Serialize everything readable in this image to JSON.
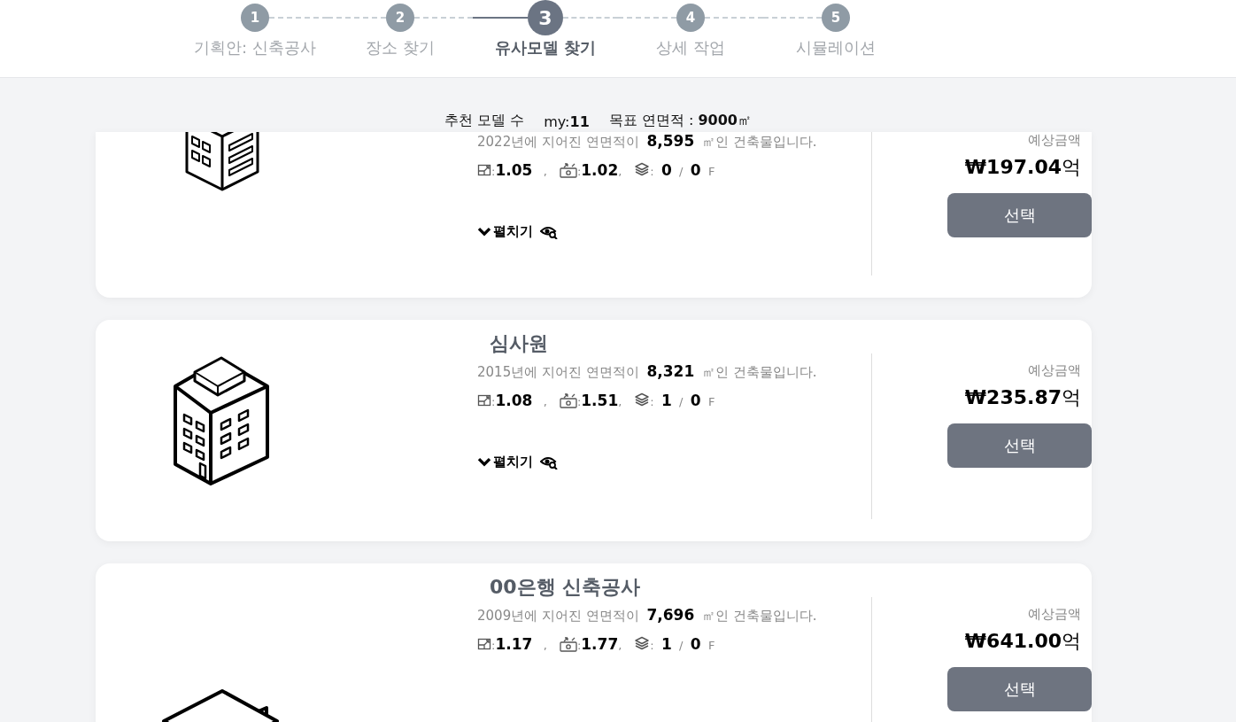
{
  "steps": [
    {
      "number": "1",
      "label": "기획안: 신축공사",
      "selected": false
    },
    {
      "number": "2",
      "label": "장소 찾기",
      "selected": false
    },
    {
      "number": "3",
      "label": "유사모델 찾기",
      "selected": true
    },
    {
      "number": "4",
      "label": "상세 작업",
      "selected": false
    },
    {
      "number": "5",
      "label": "시뮬레이션",
      "selected": false
    }
  ],
  "summary": {
    "label": "추천 모델 수",
    "count": "my:**11**",
    "target": "목표 연면적 : **9000**㎡"
  },
  "models": [
    {
      "kind": "office",
      "description": "2022년에 지어진 연면적이 **8,595** ㎡인 건축물입니다.",
      "stats": [
        {
          "text": ":**1.05**   ,"
        },
        {
          "text": ":**1.02**,"
        },
        {
          "text": ":  **0**  /  **0**  F"
        }
      ],
      "expand": "펼치기",
      "price_label": "예상금액",
      "price": "**₩197.04**억",
      "button": "선택"
    },
    {
      "kind": "tower",
      "title": "심사원",
      "description": "2015년에 지어진 연면적이 **8,321** ㎡인 건축물입니다.",
      "stats": [
        {
          "text": ":**1.08**   ,"
        },
        {
          "text": ":**1.51**,"
        },
        {
          "text": ":  **1**  /  **0**  F"
        }
      ],
      "expand": "펼치기",
      "price_label": "예상금액",
      "price": "**₩235.87**억",
      "button": "선택"
    },
    {
      "kind": "bank",
      "title": "00은행 신축공사",
      "description": "2009년에 지어진 연면적이 **7,696** ㎡인 건축물입니다.",
      "stats": [
        {
          "text": ":**1.17**   ,"
        },
        {
          "text": ":**1.77**,"
        },
        {
          "text": ":  **1**  /  **0**  F"
        }
      ],
      "price_label": "예상금액",
      "price": "**₩641.00**억",
      "button": "선택"
    }
  ]
}
